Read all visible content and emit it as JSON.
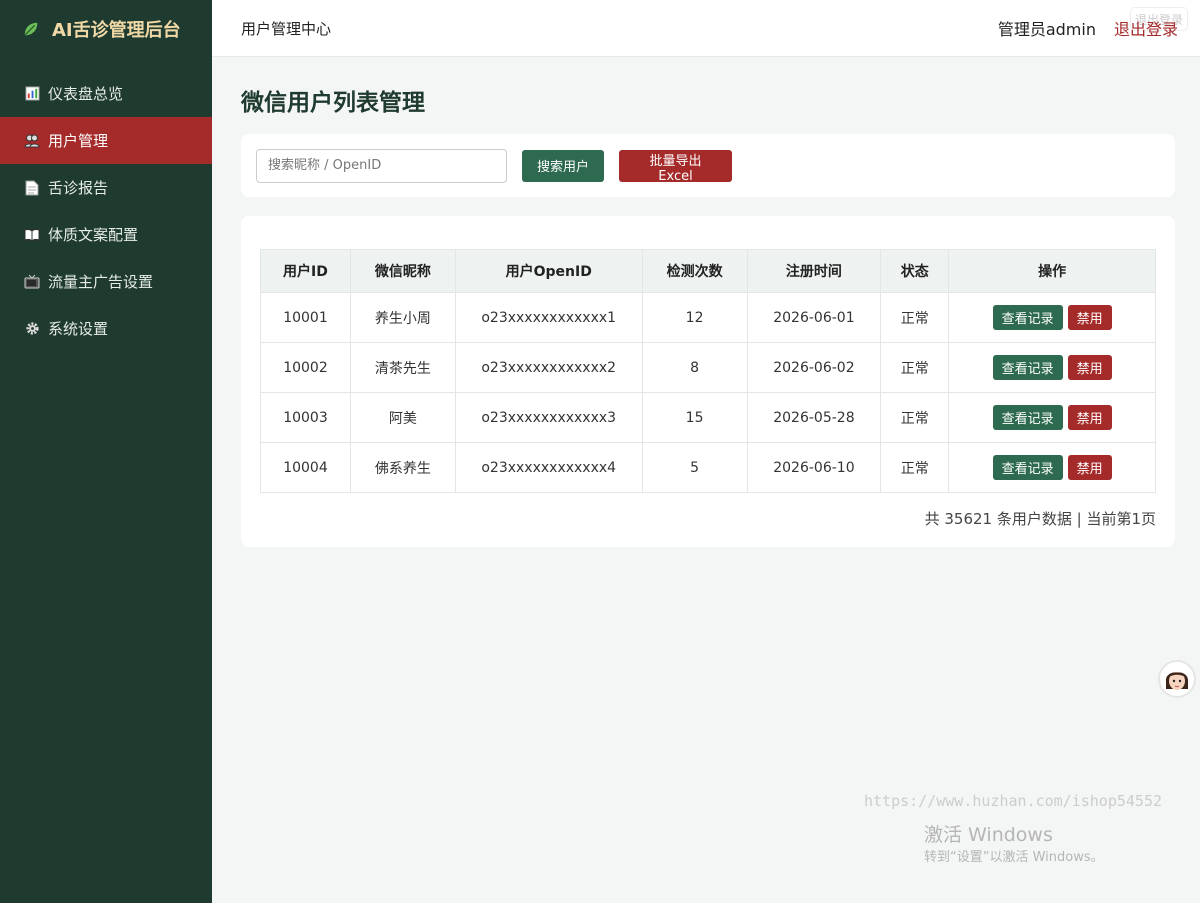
{
  "brand": {
    "title": "AI舌诊管理后台"
  },
  "sidebar": {
    "items": [
      {
        "label": "仪表盘总览",
        "icon": "bar-chart-icon"
      },
      {
        "label": "用户管理",
        "icon": "users-icon",
        "active": true
      },
      {
        "label": "舌诊报告",
        "icon": "document-icon"
      },
      {
        "label": "体质文案配置",
        "icon": "book-icon"
      },
      {
        "label": "流量主广告设置",
        "icon": "tv-icon"
      },
      {
        "label": "系统设置",
        "icon": "gear-icon"
      }
    ]
  },
  "topbar": {
    "title": "用户管理中心",
    "admin": "管理员admin",
    "logout": "退出登录",
    "logout_ghost": "退出登录"
  },
  "page": {
    "title": "微信用户列表管理"
  },
  "search": {
    "placeholder": "搜索昵称 / OpenID",
    "search_label": "搜索用户",
    "export_label": "批量导出Excel"
  },
  "table": {
    "headers": [
      "用户ID",
      "微信昵称",
      "用户OpenID",
      "检测次数",
      "注册时间",
      "状态",
      "操作"
    ],
    "rows": [
      {
        "id": "10001",
        "nickname": "养生小周",
        "openid": "o23xxxxxxxxxxxx1",
        "count": "12",
        "date": "2026-06-01",
        "status": "正常",
        "view": "查看记录",
        "ban": "禁用"
      },
      {
        "id": "10002",
        "nickname": "清茶先生",
        "openid": "o23xxxxxxxxxxxx2",
        "count": "8",
        "date": "2026-06-02",
        "status": "正常",
        "view": "查看记录",
        "ban": "禁用"
      },
      {
        "id": "10003",
        "nickname": "阿美",
        "openid": "o23xxxxxxxxxxxx3",
        "count": "15",
        "date": "2026-05-28",
        "status": "正常",
        "view": "查看记录",
        "ban": "禁用"
      },
      {
        "id": "10004",
        "nickname": "佛系养生",
        "openid": "o23xxxxxxxxxxxx4",
        "count": "5",
        "date": "2026-06-10",
        "status": "正常",
        "view": "查看记录",
        "ban": "禁用"
      }
    ],
    "footer": "共 35621 条用户数据 | 当前第1页"
  },
  "overlay": {
    "watermark_url": "https://www.huzhan.com/ishop54552",
    "win_activate": "激活 Windows",
    "win_sub": "转到“设置”以激活 Windows。"
  },
  "colors": {
    "sidebar_bg": "#1f3a2f",
    "accent_red": "#a52a2a",
    "accent_green": "#2d6a4f",
    "brand_gold": "#f0d9a6"
  }
}
